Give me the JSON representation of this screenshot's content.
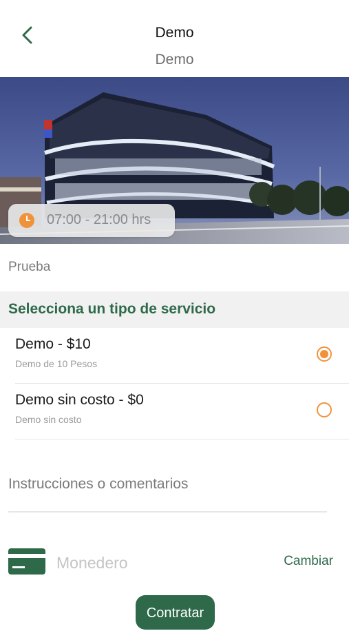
{
  "header": {
    "title": "Demo",
    "subtitle": "Demo"
  },
  "venue": {
    "hours": "07:00 - 21:00 hrs",
    "description": "Prueba"
  },
  "services": {
    "section_title": "Selecciona un tipo de servicio",
    "items": [
      {
        "title": "Demo - $10",
        "subtitle": "Demo de  10 Pesos",
        "selected": true
      },
      {
        "title": "Demo sin costo - $0",
        "subtitle": "Demo sin costo",
        "selected": false
      }
    ]
  },
  "comments": {
    "placeholder": "Instrucciones o comentarios",
    "value": ""
  },
  "payment": {
    "method": "Monedero",
    "change_label": "Cambiar"
  },
  "cta": {
    "label": "Contratar"
  },
  "colors": {
    "brand_green": "#2e6a4a",
    "accent_orange": "#f0923a"
  },
  "icons": {
    "back": "chevron-left-icon",
    "clock": "clock-icon",
    "card": "credit-card-icon"
  }
}
